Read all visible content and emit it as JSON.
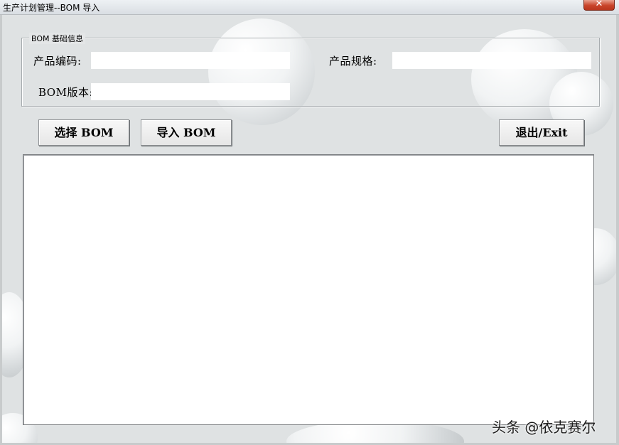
{
  "window": {
    "title": "生产计划管理--BOM 导入",
    "close_glyph": "✕"
  },
  "group": {
    "legend": "BOM 基础信息",
    "product_code_label": "产品编码:",
    "product_code_value": "",
    "product_spec_label": "产品规格:",
    "product_spec_value": "",
    "bom_version_label": "BOM版本:",
    "bom_version_value": ""
  },
  "toolbar": {
    "select_bom_label": "选择 BOM",
    "import_bom_label": "导入 BOM",
    "exit_label": "退出/Exit"
  },
  "watermark": {
    "text": "头条 @依克赛尔"
  },
  "icons": {
    "close": "close-icon"
  },
  "colors": {
    "close_button": "#c9442a",
    "background": "#dfe2e3",
    "field_background": "#ffffff"
  }
}
